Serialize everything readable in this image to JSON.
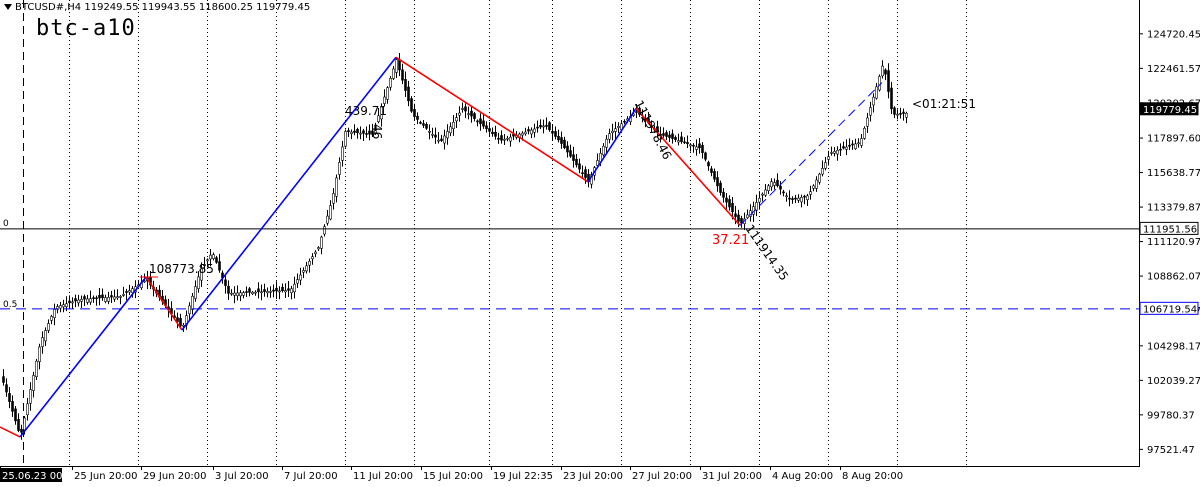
{
  "header": {
    "symbol_info": "BTCUSD#,H4  119249.55 119943.55 118600.25 119779.45",
    "indicator_label": "btc-a10"
  },
  "price_axis": {
    "ticks": [
      "124720.45",
      "122461.57",
      "120202.67",
      "117897.60",
      "115638.77",
      "113379.87",
      "111120.97",
      "108862.07",
      "106603.17",
      "104298.17",
      "102039.27",
      "99780.37",
      "97521.47"
    ],
    "current_price": "119779.45",
    "line_price_1": "111951.56",
    "line_price_2": "106719.54"
  },
  "time_axis": {
    "labels": [
      "25.06.23 00:00",
      "25 Jun 20:00",
      "29 Jun 20:00",
      "3 Jul 20:00",
      "7 Jul 20:00",
      "11 Jul 20:00",
      "15 Jul 20:00",
      "19 Jul 22:35",
      "23 Jul 20:00",
      "27 Jul 20:00",
      "31 Jul 20:00",
      "4 Aug 20:00",
      "8 Aug 20:00"
    ]
  },
  "annotations": {
    "price_108773": "108773.85",
    "value_439": "439.71",
    "value_46": "46",
    "price_111978": "111978.46",
    "ratio_3721": "37.21",
    "price_111914": "111914.35",
    "timer": "<01:21:51",
    "level_0": "0",
    "level_05": "0.5"
  },
  "colors": {
    "bull": "#000000",
    "bear": "#000000",
    "zigzag_up": "#0000ff",
    "zigzag_down": "#ff0000",
    "grid": "#000000",
    "highlight_tag": "#000000"
  },
  "chart_data": {
    "type": "candlestick",
    "symbol": "BTCUSD#",
    "timeframe": "H4",
    "ylim": [
      96400,
      126900
    ],
    "current": {
      "open": 119249.55,
      "high": 119943.55,
      "low": 118600.25,
      "close": 119779.45
    },
    "horizontal_lines": [
      111951.56,
      106719.54
    ],
    "zigzag_points": [
      {
        "t": "25 Jun 00:00",
        "price": 98950,
        "color": "red"
      },
      {
        "t": "25 Jun 08:00",
        "price": 98300,
        "color": "blue"
      },
      {
        "t": "30 Jun 00:00",
        "price": 108773.85,
        "color": "red"
      },
      {
        "t": "1 Jul 12:00",
        "price": 105300,
        "color": "blue"
      },
      {
        "t": "13 Jul 00:00",
        "price": 123150,
        "color": "red"
      },
      {
        "t": "25 Jul 04:00",
        "price": 115000,
        "color": "blue"
      },
      {
        "t": "28 Jul 04:00",
        "price": 119800,
        "color": "red"
      },
      {
        "t": "1 Aug 16:00",
        "price": 112150
      }
    ],
    "swing_values": [
      "108773.85",
      "439.71",
      "111978.46",
      "37.21",
      "111914.35"
    ]
  }
}
